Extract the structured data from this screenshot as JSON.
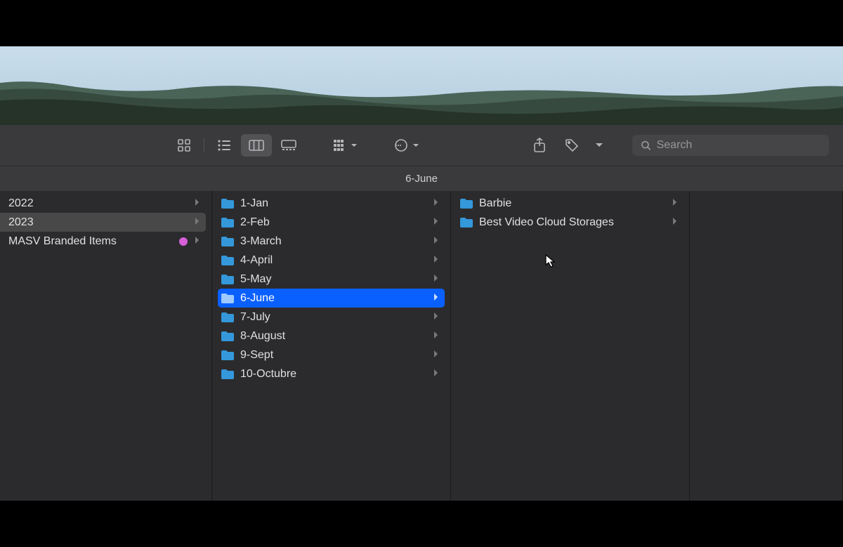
{
  "path_title": "6-June",
  "search": {
    "placeholder": "Search"
  },
  "colors": {
    "tag_pink": "#d560d8",
    "folder": "#3fa8ef",
    "highlight": "#0a60ff"
  },
  "columns": [
    {
      "items": [
        {
          "label": "2022",
          "selected": false
        },
        {
          "label": "2023",
          "selected": true
        },
        {
          "label": "MASV Branded Items",
          "selected": false,
          "tag": "#d560d8"
        }
      ]
    },
    {
      "items": [
        {
          "label": "1-Jan",
          "selected": false
        },
        {
          "label": "2-Feb",
          "selected": false
        },
        {
          "label": "3-March",
          "selected": false
        },
        {
          "label": "4-April",
          "selected": false
        },
        {
          "label": "5-May",
          "selected": false
        },
        {
          "label": "6-June",
          "selected": true,
          "highlighted": true
        },
        {
          "label": "7-July",
          "selected": false
        },
        {
          "label": "8-August",
          "selected": false
        },
        {
          "label": "9-Sept",
          "selected": false
        },
        {
          "label": "10-Octubre",
          "selected": false
        }
      ]
    },
    {
      "items": [
        {
          "label": "Barbie",
          "selected": false
        },
        {
          "label": "Best Video Cloud Storages",
          "selected": false
        }
      ]
    },
    {
      "items": []
    }
  ]
}
